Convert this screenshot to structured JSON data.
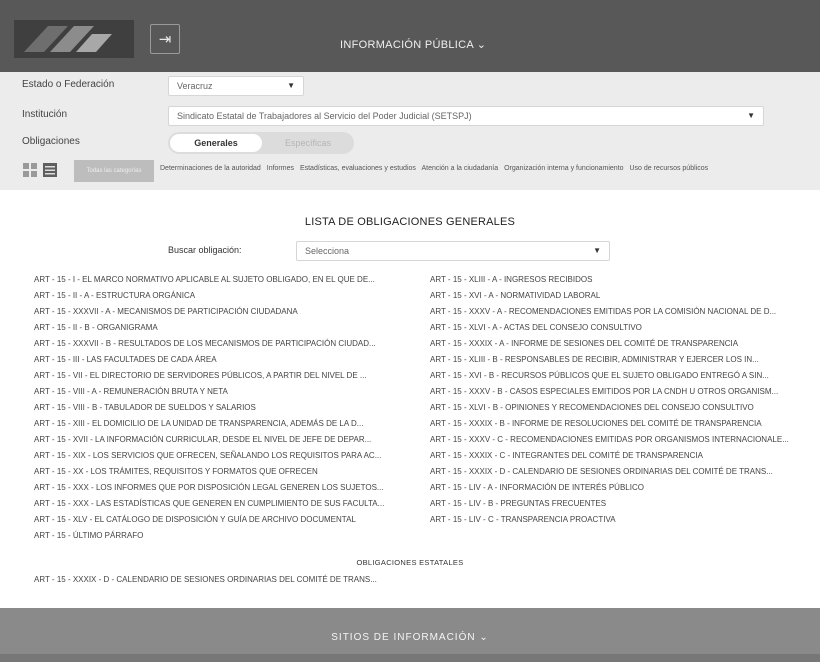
{
  "header": {
    "export_icon_glyph": "⇥",
    "title": "INFORMACIÓN PÚBLICA ⌄",
    "logo_icon": "pnt-logo-icon"
  },
  "filters": {
    "estado_label": "Estado o Federación",
    "estado_value": "Veracruz",
    "institucion_label": "Institución",
    "institucion_value": "Sindicato Estatal de Trabajadores al Servicio del Poder Judicial (SETSPJ)",
    "obligaciones_label": "Obligaciones",
    "tab_generales": "Generales",
    "tab_especificas": "Específicas",
    "category_button": "Todas las categorías",
    "categories": [
      "Determinaciones de la autoridad",
      "Informes",
      "Estadísticas, evaluaciones y estudios",
      "Atención a la ciudadanía",
      "Organización interna y funcionamiento",
      "Uso de recursos públicos"
    ]
  },
  "list": {
    "title": "LISTA DE OBLIGACIONES GENERALES",
    "search_label": "Buscar obligación:",
    "search_value": "Selecciona",
    "left_items": [
      "ART - 15 - I - EL MARCO NORMATIVO APLICABLE AL SUJETO OBLIGADO, EN EL QUE DE...",
      "ART - 15 - II - A - ESTRUCTURA ORGÁNICA",
      "ART - 15 - XXXVII - A - MECANISMOS DE PARTICIPACIÓN CIUDADANA",
      "ART - 15 - II - B - ORGANIGRAMA",
      "ART - 15 - XXXVII - B - RESULTADOS DE LOS MECANISMOS DE PARTICIPACIÓN CIUDAD...",
      "ART - 15 - III - LAS FACULTADES DE CADA ÁREA",
      "ART - 15 - VII - EL DIRECTORIO DE SERVIDORES PÚBLICOS, A PARTIR DEL NIVEL DE ...",
      "ART - 15 - VIII - A - REMUNERACIÓN BRUTA Y NETA",
      "ART - 15 - VIII - B - TABULADOR DE SUELDOS Y SALARIOS",
      "ART - 15 - XIII - EL DOMICILIO DE LA UNIDAD DE TRANSPARENCIA, ADEMÁS DE LA D...",
      "ART - 15 - XVII - LA INFORMACIÓN CURRICULAR, DESDE EL NIVEL DE JEFE DE DEPAR...",
      "ART - 15 - XIX - LOS SERVICIOS QUE OFRECEN, SEÑALANDO LOS REQUISITOS PARA AC...",
      "ART - 15 - XX - LOS TRÁMITES, REQUISITOS Y FORMATOS QUE OFRECEN",
      "ART - 15 - XXX - LOS INFORMES QUE POR DISPOSICIÓN LEGAL GENEREN LOS SUJETOS...",
      "ART - 15 - XXX - LAS ESTADÍSTICAS QUE GENEREN EN CUMPLIMIENTO DE SUS FACULTA...",
      "ART - 15 - XLV - EL CATÁLOGO DE DISPOSICIÓN Y GUÍA DE ARCHIVO DOCUMENTAL",
      "ART - 15 - ÚLTIMO PÁRRAFO"
    ],
    "right_items": [
      "ART - 15 - XLIII - A - INGRESOS RECIBIDOS",
      "ART - 15 - XVI - A - NORMATIVIDAD LABORAL",
      "ART - 15 - XXXV - A - RECOMENDACIONES EMITIDAS POR LA COMISIÓN NACIONAL DE D...",
      "ART - 15 - XLVI - A - ACTAS DEL CONSEJO CONSULTIVO",
      "ART - 15 - XXXIX - A - INFORME DE SESIONES DEL COMITÉ DE TRANSPARENCIA",
      "ART - 15 - XLIII - B - RESPONSABLES DE RECIBIR, ADMINISTRAR Y EJERCER LOS IN...",
      "ART - 15 - XVI - B - RECURSOS PÚBLICOS QUE EL SUJETO OBLIGADO ENTREGÓ A SIN...",
      "ART - 15 - XXXV - B - CASOS ESPECIALES EMITIDOS POR LA CNDH U OTROS ORGANISM...",
      "ART - 15 - XLVI - B - OPINIONES Y RECOMENDACIONES DEL CONSEJO CONSULTIVO",
      "ART - 15 - XXXIX - B - INFORME DE RESOLUCIONES DEL COMITÉ DE TRANSPARENCIA",
      "ART - 15 - XXXV - C - RECOMENDACIONES EMITIDAS POR ORGANISMOS INTERNACIONALE...",
      "ART - 15 - XXXIX - C - INTEGRANTES DEL COMITÉ DE TRANSPARENCIA",
      "ART - 15 - XXXIX - D - CALENDARIO DE SESIONES ORDINARIAS DEL COMITÉ DE TRANS...",
      "ART - 15 - LIV - A - INFORMACIÓN DE INTERÉS PÚBLICO",
      "ART - 15 - LIV - B - PREGUNTAS FRECUENTES",
      "ART - 15 - LIV - C - TRANSPARENCIA PROACTIVA"
    ],
    "estatales_title": "OBLIGACIONES ESTATALES",
    "estatales_items": [
      "ART - 15 - XXXIX - D - CALENDARIO DE SESIONES ORDINARIAS DEL COMITÉ DE TRANS..."
    ]
  },
  "footer": {
    "title": "SITIOS DE INFORMACIÓN ⌄"
  }
}
